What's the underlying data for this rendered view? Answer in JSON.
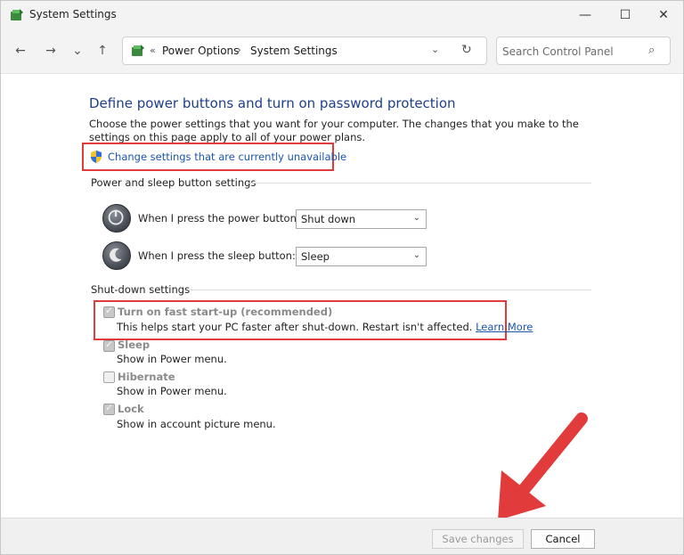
{
  "window": {
    "title": "System Settings",
    "minimize_glyph": "—",
    "maximize_glyph": "☐",
    "close_glyph": "✕"
  },
  "nav": {
    "back_glyph": "←",
    "forward_glyph": "→",
    "recent_glyph": "⌄",
    "up_glyph": "↑",
    "breadcrumb_chevron": "«",
    "breadcrumb_separator": "›",
    "breadcrumbs": [
      "Power Options",
      "System Settings"
    ],
    "dropdown_glyph": "⌄",
    "refresh_glyph": "↻",
    "search_placeholder": "Search Control Panel",
    "search_glyph": "⌕"
  },
  "content": {
    "heading": "Define power buttons and turn on password protection",
    "description": "Choose the power settings that you want for your computer. The changes that you make to the settings on this page apply to all of your power plans.",
    "change_link": "Change settings that are currently unavailable",
    "power_section": "Power and sleep button settings",
    "power_button_label": "When I press the power button:",
    "power_button_value": "Shut down",
    "sleep_button_label": "When I press the sleep button:",
    "sleep_button_value": "Sleep",
    "caret_glyph": "⌄",
    "shutdown_section": "Shut-down settings",
    "options": [
      {
        "title": "Turn on fast start-up (recommended)",
        "desc": "This helps start your PC faster after shut-down. Restart isn't affected.",
        "link": "Learn More",
        "checked": true
      },
      {
        "title": "Sleep",
        "desc": "Show in Power menu.",
        "checked": true
      },
      {
        "title": "Hibernate",
        "desc": "Show in Power menu.",
        "checked": false
      },
      {
        "title": "Lock",
        "desc": "Show in account picture menu.",
        "checked": true
      }
    ]
  },
  "footer": {
    "save_label": "Save changes",
    "cancel_label": "Cancel"
  },
  "colors": {
    "highlight_red": "#e23b3b",
    "link_blue": "#1a56b0",
    "heading_blue": "#1e3f8a"
  }
}
